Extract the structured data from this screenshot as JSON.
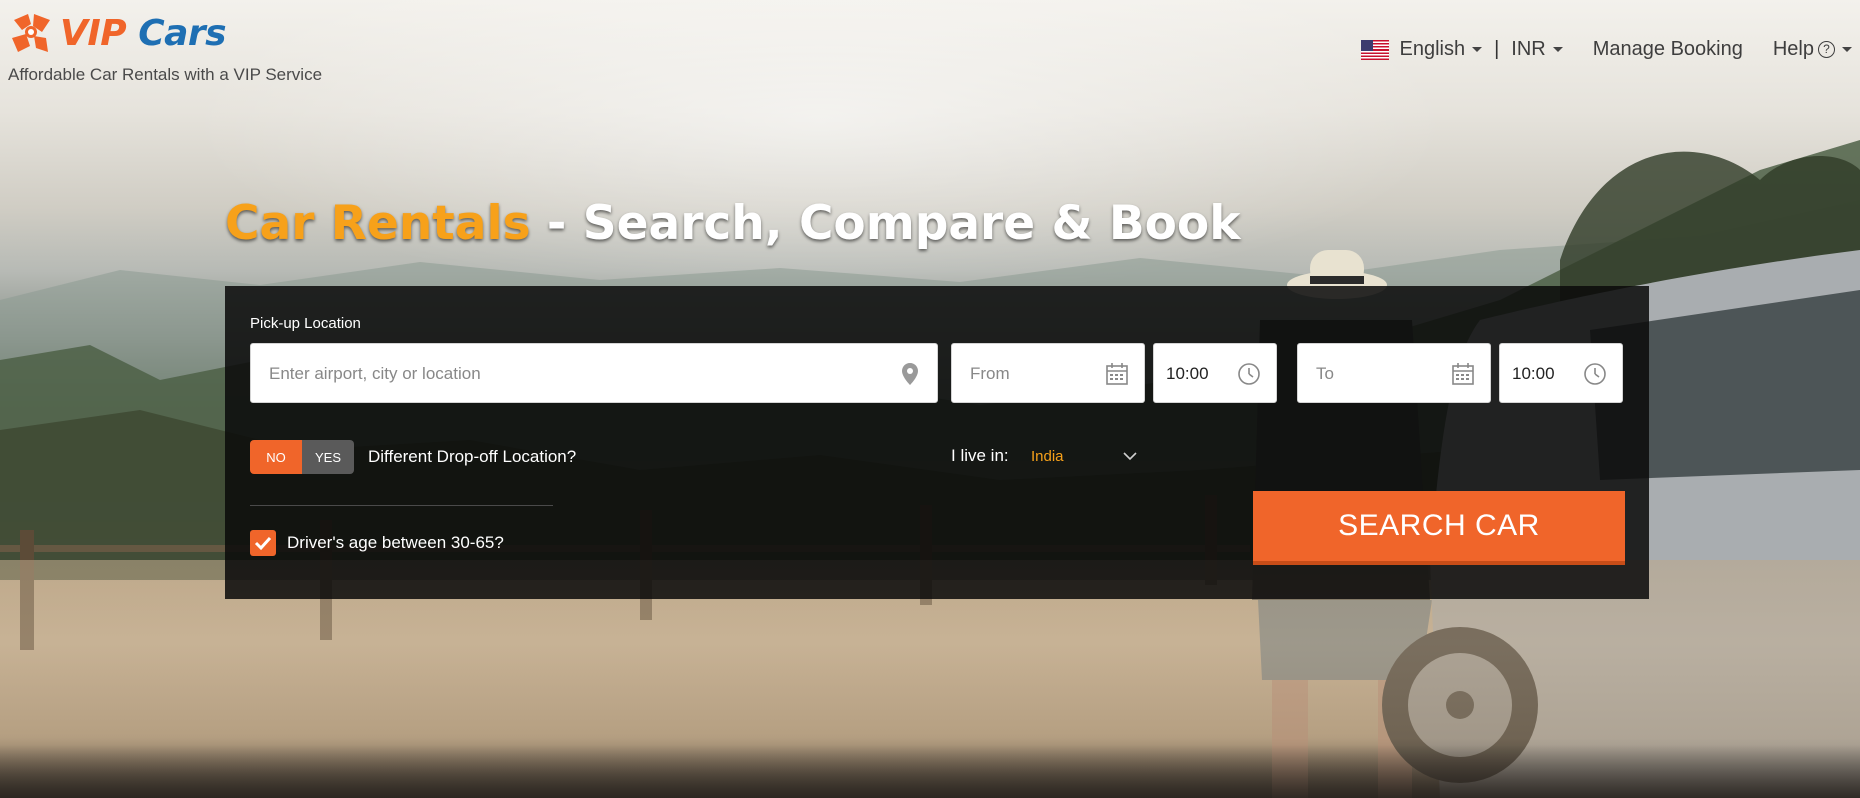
{
  "brand": {
    "name_part1": "VIP",
    "name_part2": "Cars",
    "tagline": "Affordable Car Rentals with a VIP Service",
    "accent_color": "#f0652a",
    "secondary_color": "#1e6fb3"
  },
  "topnav": {
    "language": "English",
    "currency": "INR",
    "separator": "|",
    "manage_booking": "Manage Booking",
    "help": "Help",
    "help_icon": "question-circle-icon",
    "flag_icon": "us-flag-icon"
  },
  "hero": {
    "headline_accent": "Car Rentals",
    "headline_rest": " - Search, Compare & Book"
  },
  "search": {
    "pickup_label": "Pick-up Location",
    "pickup_placeholder": "Enter airport, city or location",
    "from_placeholder": "From",
    "from_time": "10:00",
    "to_placeholder": "To",
    "to_time": "10:00",
    "dropoff_toggle": {
      "no": "NO",
      "yes": "YES",
      "selected": "NO"
    },
    "dropoff_label": "Different Drop-off Location?",
    "live_in_label": "I live in:",
    "live_in_value": "India",
    "driver_age_label": "Driver's age between 30-65?",
    "driver_age_checked": true,
    "search_button": "SEARCH CAR"
  }
}
